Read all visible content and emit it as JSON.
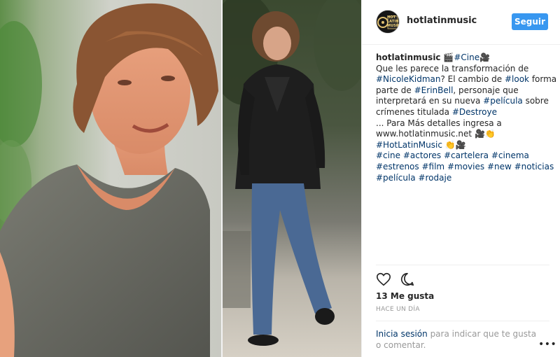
{
  "header": {
    "username": "hotlatinmusic",
    "follow_label": "Seguir",
    "avatar_text": "HOT LATIN MUSIC"
  },
  "caption": {
    "username": "hotlatinmusic",
    "line1_icon": "🎬",
    "line1_tag": "#Cine",
    "line1_icon2": "🎥",
    "line2": "Que les parece la transformación de",
    "line3_tag1": "#NicoleKidman",
    "line3_text": "? El cambio de ",
    "line3_tag2": "#look",
    "line3_text2": " forma",
    "line4_text": "parte de ",
    "line4_tag": "#ErinBell",
    "line4_text2": ", personaje que",
    "line5_text": "interpretará en su nueva ",
    "line5_tag": "#película",
    "line5_text2": " sobre",
    "line6_text": "crímenes titulada ",
    "line6_tag": "#Destroye",
    "line7": "... Para Más detalles ingresa a",
    "line8_text": "www.hotlatinmusic.net ",
    "line8_icons": "🎥👏",
    "line9_tag": "#HotLatinMusic",
    "line9_icons": " 👏🎥",
    "line10": [
      {
        "tag": "#cine"
      },
      {
        "tag": "#actores"
      },
      {
        "tag": "#cartelera"
      },
      {
        "tag": "#cinema"
      }
    ],
    "line11": [
      {
        "tag": "#estrenos"
      },
      {
        "tag": "#film"
      },
      {
        "tag": "#movies"
      },
      {
        "tag": "#new"
      },
      {
        "tag": "#noticias"
      }
    ],
    "line12": [
      {
        "tag": "#película"
      },
      {
        "tag": "#rodaje"
      }
    ]
  },
  "actions": {
    "like_icon": "heart-icon",
    "comment_icon": "comment-icon"
  },
  "likes": "13 Me gusta",
  "time": "HACE UN DÍA",
  "login": {
    "link": "Inicia sesión",
    "text": " para indicar que te gusta o comentar."
  },
  "more": "•••",
  "colors": {
    "accent": "#3897f0",
    "link": "#003569",
    "muted": "#999999",
    "text": "#262626"
  }
}
